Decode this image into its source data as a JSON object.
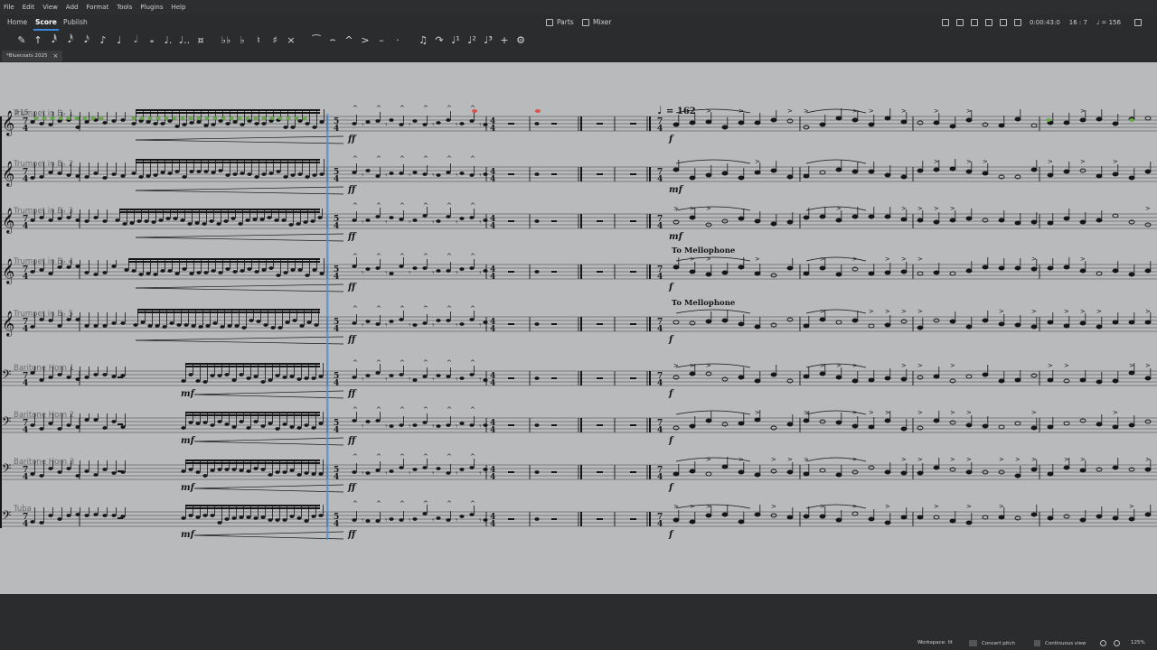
{
  "menu": [
    "File",
    "Edit",
    "View",
    "Add",
    "Format",
    "Tools",
    "Plugins",
    "Help"
  ],
  "nav": {
    "tabs": [
      "Home",
      "Score",
      "Publish"
    ],
    "active_tab": "Score",
    "parts_label": "Parts",
    "mixer_label": "Mixer"
  },
  "playback": {
    "time": "0:00:43:0",
    "position": "16 : 7",
    "tempo": "♩ = 156"
  },
  "toolbar_icons": [
    {
      "name": "note-input-icon",
      "glyph": "✎"
    },
    {
      "name": "accent-marker-icon",
      "glyph": "↑"
    },
    {
      "name": "64th-note-icon",
      "glyph": "𝅘𝅥𝅱"
    },
    {
      "name": "32nd-note-icon",
      "glyph": "𝅘𝅥𝅰"
    },
    {
      "name": "16th-note-icon",
      "glyph": "𝅘𝅥𝅯"
    },
    {
      "name": "eighth-note-icon",
      "glyph": "♪"
    },
    {
      "name": "quarter-note-icon",
      "glyph": "♩"
    },
    {
      "name": "half-note-icon",
      "glyph": "𝅗𝅥"
    },
    {
      "name": "whole-note-icon",
      "glyph": "𝅝"
    },
    {
      "name": "dot-icon",
      "glyph": "♩."
    },
    {
      "name": "double-dot-icon",
      "glyph": "♩.."
    },
    {
      "name": "rest-icon",
      "glyph": "¤"
    },
    {
      "name": "sep",
      "glyph": ""
    },
    {
      "name": "double-flat-icon",
      "glyph": "♭♭"
    },
    {
      "name": "flat-icon",
      "glyph": "♭"
    },
    {
      "name": "natural-icon",
      "glyph": "♮"
    },
    {
      "name": "sharp-icon",
      "glyph": "♯"
    },
    {
      "name": "double-sharp-icon",
      "glyph": "×"
    },
    {
      "name": "sep",
      "glyph": ""
    },
    {
      "name": "tie-icon",
      "glyph": "⁀"
    },
    {
      "name": "slur-icon",
      "glyph": "⌢"
    },
    {
      "name": "marcato-icon",
      "glyph": "^"
    },
    {
      "name": "accent-icon",
      "glyph": ">"
    },
    {
      "name": "tenuto-icon",
      "glyph": "–"
    },
    {
      "name": "staccato-icon",
      "glyph": "·"
    },
    {
      "name": "sep",
      "glyph": ""
    },
    {
      "name": "tuplet-icon",
      "glyph": "♫"
    },
    {
      "name": "flip-direction-icon",
      "glyph": "↷"
    },
    {
      "name": "voice-1-icon",
      "glyph": "♩¹"
    },
    {
      "name": "voice-2-icon",
      "glyph": "♩²"
    },
    {
      "name": "voice-3-icon",
      "glyph": "♩³"
    },
    {
      "name": "add-icon",
      "glyph": "+"
    },
    {
      "name": "customize-toolbar-icon",
      "glyph": "⚙"
    }
  ],
  "document_tab": {
    "title": "*Bluecoats 2025"
  },
  "score": {
    "measure_number": "#15",
    "instruments": [
      {
        "name": "Trumpet in B♭ 1",
        "clef": "treble"
      },
      {
        "name": "Trumpet in B♭ 2",
        "clef": "treble"
      },
      {
        "name": "Trumpet in B♭ 3",
        "clef": "treble"
      },
      {
        "name": "Trumpet in B♭ 4",
        "clef": "treble"
      },
      {
        "name": "Trumpet in B♭ 5",
        "clef": "treble"
      },
      {
        "name": "Baritone Horn 1",
        "clef": "bass"
      },
      {
        "name": "Baritone Horn 2",
        "clef": "bass"
      },
      {
        "name": "Baritone Horn 3",
        "clef": "bass"
      },
      {
        "name": "Tuba",
        "clef": "bass"
      }
    ],
    "tempo_marking": "= 162",
    "text_marking": "To Mellophone",
    "dynamics": {
      "ff": "ff",
      "f": "f",
      "mf": "mf"
    }
  },
  "status": {
    "workspace": "Workspace: lit",
    "concert_pitch": "Concert pitch",
    "view_mode": "Continuous view",
    "zoom": "125%"
  },
  "colors": {
    "canvas": "#b9babc",
    "ink": "#151515",
    "selection": "#4a8fd1",
    "accent": "#3a86d8",
    "green_notes": "#6aa84f",
    "red_notes": "#d9534f"
  }
}
